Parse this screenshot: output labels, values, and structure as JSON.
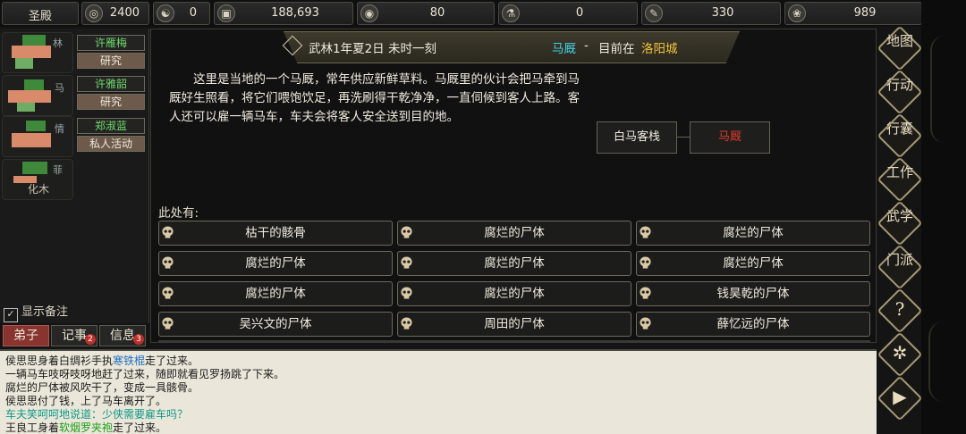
{
  "resources": {
    "rank": "圣殿",
    "items": [
      {
        "icon": "coin-icon",
        "value": "2400"
      },
      {
        "icon": "yinyang-icon",
        "value": "0"
      },
      {
        "icon": "copper-coin-icon",
        "value": "188,693"
      },
      {
        "icon": "food-bowl-icon",
        "value": "80"
      },
      {
        "icon": "mortar-icon",
        "value": "0"
      },
      {
        "icon": "scroll-icon",
        "value": "330"
      },
      {
        "icon": "dragon-icon",
        "value": "989"
      }
    ]
  },
  "party": {
    "members": [
      {
        "name": "许雁梅",
        "activity": "研究"
      },
      {
        "name": "许雅韶",
        "activity": "研究"
      },
      {
        "name": "郑淑蓝",
        "activity": "私人活动"
      }
    ],
    "slot_fragments": [
      "林",
      "马",
      "情",
      "菲",
      "化木"
    ],
    "show_notes": "显示备注"
  },
  "tabs": [
    {
      "label": "弟子",
      "badge": ""
    },
    {
      "label": "记事",
      "badge": "2"
    },
    {
      "label": "信息",
      "badge": "3"
    }
  ],
  "header": {
    "date": "武林1年夏2日 未时一刻",
    "location": "马厩",
    "separator": "-",
    "current_prefix": "目前在",
    "city": "洛阳城"
  },
  "description": "这里是当地的一个马厩，常年供应新鲜草料。马厩里的伙计会把马牵到马厩好生照看，将它们喂饱饮足，再洗刷得干乾净净，一直伺候到客人上路。客人还可以雇一辆马车，车夫会将客人安全送到目的地。",
  "map": {
    "nodes": [
      {
        "label": "白马客栈",
        "current": false
      },
      {
        "label": "马厩",
        "current": true
      }
    ]
  },
  "here_label": "此处有:",
  "objects": [
    "枯干的骸骨",
    "腐烂的尸体",
    "腐烂的尸体",
    "腐烂的尸体",
    "腐烂的尸体",
    "腐烂的尸体",
    "腐烂的尸体",
    "腐烂的尸体",
    "钱昊乾的尸体",
    "吴兴文的尸体",
    "周田的尸体",
    "薛忆远的尸体"
  ],
  "log": [
    [
      {
        "t": "侯思思身着白绸衫手执"
      },
      {
        "t": "寒铁棍",
        "c": "blue"
      },
      {
        "t": "走了过来。"
      }
    ],
    [
      {
        "t": "一辆马车吱呀吱呀地赶了过来，随即就看见罗扬跳了下来。"
      }
    ],
    [
      {
        "t": "腐烂的尸体被风吹干了，变成一具骸骨。"
      }
    ],
    [
      {
        "t": "侯思思付了钱，上了马车离开了。"
      }
    ],
    [
      {
        "t": "车夫笑呵呵地说道：少侠需要雇车吗？",
        "c": "teal"
      }
    ],
    [
      {
        "t": "王良工身着"
      },
      {
        "t": "软烟罗夹袍",
        "c": "green"
      },
      {
        "t": "走了过来。"
      }
    ]
  ],
  "sidebar": [
    {
      "label": "地图",
      "icon": ""
    },
    {
      "label": "行动",
      "icon": ""
    },
    {
      "label": "行囊",
      "icon": ""
    },
    {
      "label": "工作",
      "icon": ""
    },
    {
      "label": "武学",
      "icon": ""
    },
    {
      "label": "门派",
      "icon": ""
    },
    {
      "label": "",
      "icon": "help-icon"
    },
    {
      "label": "",
      "icon": "settings-gear-icon"
    },
    {
      "label": "",
      "icon": "play-icon"
    }
  ],
  "colors": {
    "location": "#3fd3e6",
    "city": "#f0c43a",
    "current_node": "#e23a2a",
    "name_green": "#6fdc6f"
  }
}
